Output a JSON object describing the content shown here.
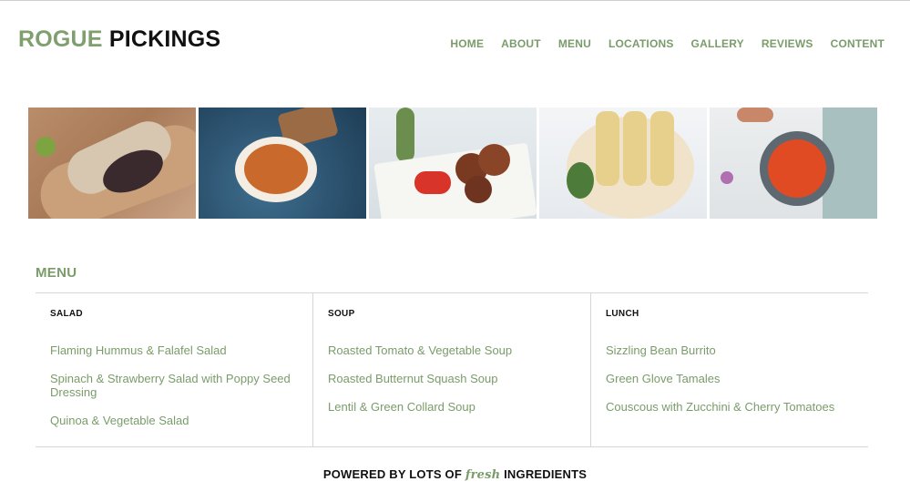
{
  "header": {
    "logo_part1": "ROGUE",
    "logo_part2": "PICKINGS",
    "nav": [
      "HOME",
      "ABOUT",
      "MENU",
      "LOCATIONS",
      "GALLERY",
      "REVIEWS",
      "CONTENT"
    ]
  },
  "gallery": {
    "photos": [
      "burrito-photo",
      "pumpkin-soup-photo",
      "falafel-box-photo",
      "tamales-photo",
      "tomato-soup-photo"
    ]
  },
  "menu": {
    "title": "MENU",
    "columns": [
      {
        "heading": "SALAD",
        "items": [
          "Flaming Hummus & Falafel Salad",
          "Spinach & Strawberry Salad with Poppy Seed Dressing",
          "Quinoa & Vegetable Salad"
        ]
      },
      {
        "heading": "SOUP",
        "items": [
          "Roasted Tomato & Vegetable Soup",
          "Roasted Butternut Squash Soup",
          "Lentil & Green Collard Soup"
        ]
      },
      {
        "heading": "LUNCH",
        "items": [
          "Sizzling Bean Burrito",
          "Green Glove Tamales",
          "Couscous with Zucchini & Cherry Tomatoes"
        ]
      }
    ]
  },
  "footer": {
    "before": "POWERED BY LOTS OF",
    "accent": "fresh",
    "after": "INGREDIENTS"
  },
  "colors": {
    "accent_green": "#7a9c6a",
    "text_dark": "#111111",
    "divider": "#d6d6d6"
  }
}
